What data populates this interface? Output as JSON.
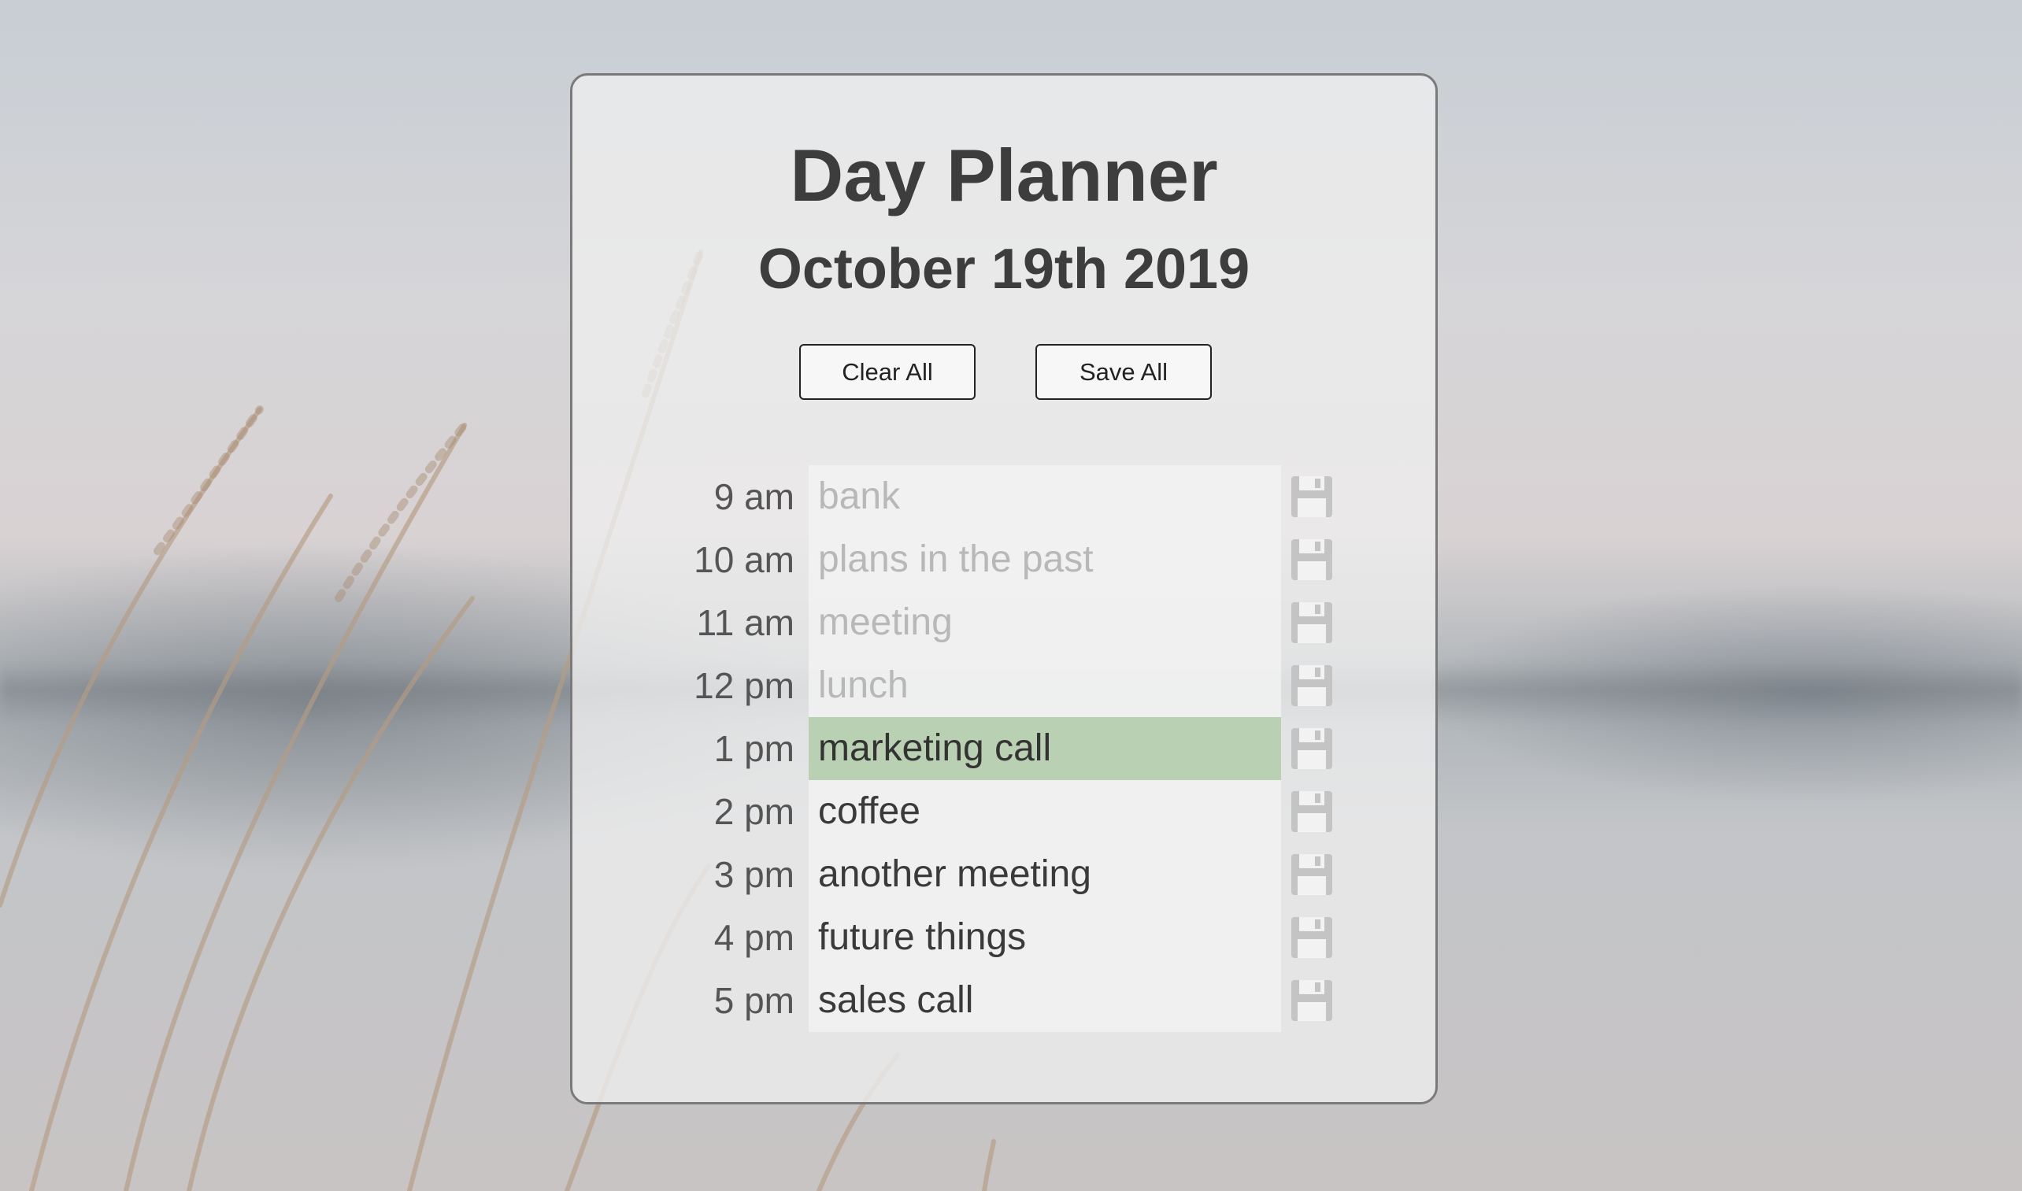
{
  "header": {
    "title": "Day Planner",
    "date": "October 19th 2019"
  },
  "actions": {
    "clear_all": "Clear All",
    "save_all": "Save All"
  },
  "icons": {
    "save": "floppy-disk-icon"
  },
  "colors": {
    "current_hour_bg": "#b2cdaa",
    "past_text": "#b8b8b8",
    "text": "#3a3a3a"
  },
  "schedule": [
    {
      "time": "9 am",
      "task": "bank",
      "status": "past"
    },
    {
      "time": "10 am",
      "task": "plans in the past",
      "status": "past"
    },
    {
      "time": "11 am",
      "task": "meeting",
      "status": "past"
    },
    {
      "time": "12 pm",
      "task": "lunch",
      "status": "past"
    },
    {
      "time": "1 pm",
      "task": "marketing call",
      "status": "present"
    },
    {
      "time": "2 pm",
      "task": "coffee",
      "status": "future"
    },
    {
      "time": "3 pm",
      "task": "another meeting",
      "status": "future"
    },
    {
      "time": "4 pm",
      "task": "future things",
      "status": "future"
    },
    {
      "time": "5 pm",
      "task": "sales call",
      "status": "future"
    }
  ]
}
